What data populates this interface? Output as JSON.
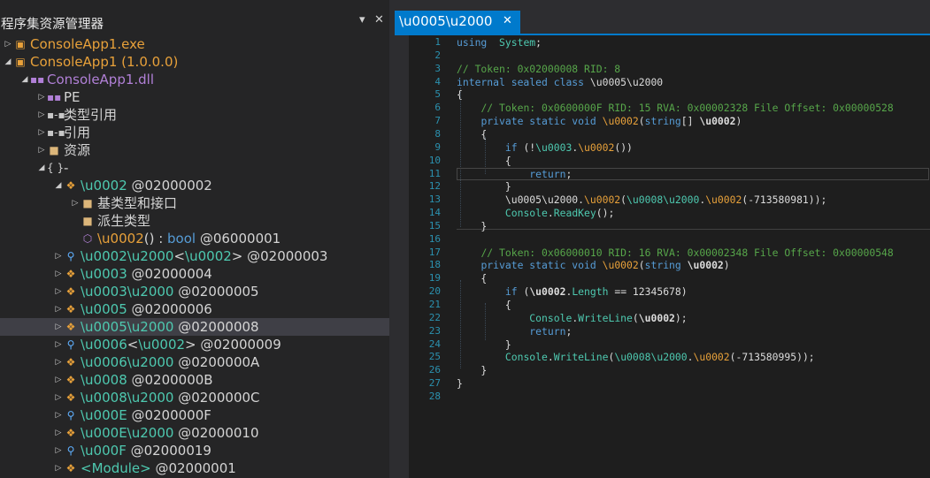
{
  "panel": {
    "title": "程序集资源管理器",
    "pin_glyph": "▾",
    "close_glyph": "✕"
  },
  "tree": [
    {
      "indent": 0,
      "arrow": "▷",
      "icon": "exe-icon",
      "glyph": "▣",
      "icon_color": "#e8a13a",
      "text": "ConsoleApp1.exe",
      "color": "#e8a13a"
    },
    {
      "indent": 0,
      "arrow": "◢",
      "icon": "assembly-icon",
      "glyph": "▣",
      "icon_color": "#e8a13a",
      "text": "ConsoleApp1 (1.0.0.0)",
      "color": "#e8a13a"
    },
    {
      "indent": 1,
      "arrow": "◢",
      "icon": "module-icon",
      "glyph": "▪▪",
      "icon_color": "#b180d7",
      "text": "ConsoleApp1.dll",
      "color": "#b180d7"
    },
    {
      "indent": 2,
      "arrow": "▷",
      "icon": "pe-icon",
      "glyph": "▪▪",
      "icon_color": "#b180d7",
      "text": "PE",
      "color": "#d4d4d4"
    },
    {
      "indent": 2,
      "arrow": "▷",
      "icon": "references-icon",
      "glyph": "▪-▪",
      "icon_color": "#c8c8c8",
      "text": "类型引用",
      "color": "#d4d4d4"
    },
    {
      "indent": 2,
      "arrow": "▷",
      "icon": "references-icon",
      "glyph": "▪-▪",
      "icon_color": "#c8c8c8",
      "text": "引用",
      "color": "#d4d4d4"
    },
    {
      "indent": 2,
      "arrow": "▷",
      "icon": "folder-icon",
      "glyph": "■",
      "icon_color": "#dcb67a",
      "text": "资源",
      "color": "#d4d4d4"
    },
    {
      "indent": 2,
      "arrow": "◢",
      "icon": "namespace-icon",
      "glyph": "{ }",
      "icon_color": "#d4d4d4",
      "text": "-",
      "color": "#d4d4d4"
    },
    {
      "indent": 3,
      "arrow": "◢",
      "icon": "class-icon",
      "glyph": "❖",
      "icon_color": "#e8a13a",
      "parts": [
        {
          "t": "\\u0002",
          "c": "#4ec9b0"
        },
        {
          "t": " @02000002",
          "c": "#d4d4d4"
        }
      ]
    },
    {
      "indent": 4,
      "arrow": "▷",
      "icon": "folder-icon",
      "glyph": "■",
      "icon_color": "#dcb67a",
      "text": "基类型和接口",
      "color": "#d4d4d4"
    },
    {
      "indent": 4,
      "arrow": "",
      "icon": "folder-icon",
      "glyph": "■",
      "icon_color": "#dcb67a",
      "text": "派生类型",
      "color": "#d4d4d4"
    },
    {
      "indent": 4,
      "arrow": "",
      "icon": "method-icon",
      "glyph": "⬡",
      "icon_color": "#b180d7",
      "parts": [
        {
          "t": "\\u0002",
          "c": "#e8a13a"
        },
        {
          "t": "() : ",
          "c": "#d4d4d4"
        },
        {
          "t": "bool",
          "c": "#569cd6"
        },
        {
          "t": " @06000001",
          "c": "#d4d4d4"
        }
      ]
    },
    {
      "indent": 3,
      "arrow": "▷",
      "icon": "class-generic-icon",
      "glyph": "⚲",
      "icon_color": "#5fb0ff",
      "parts": [
        {
          "t": "\\u0002\\u2000",
          "c": "#4ec9b0"
        },
        {
          "t": "<",
          "c": "#d4d4d4"
        },
        {
          "t": "\\u0002",
          "c": "#4ec9b0"
        },
        {
          "t": "> @02000003",
          "c": "#d4d4d4"
        }
      ]
    },
    {
      "indent": 3,
      "arrow": "▷",
      "icon": "class-icon",
      "glyph": "❖",
      "icon_color": "#e8a13a",
      "parts": [
        {
          "t": "\\u0003",
          "c": "#4ec9b0"
        },
        {
          "t": " @02000004",
          "c": "#d4d4d4"
        }
      ]
    },
    {
      "indent": 3,
      "arrow": "▷",
      "icon": "class-icon",
      "glyph": "❖",
      "icon_color": "#e8a13a",
      "parts": [
        {
          "t": "\\u0003\\u2000",
          "c": "#4ec9b0"
        },
        {
          "t": " @02000005",
          "c": "#d4d4d4"
        }
      ]
    },
    {
      "indent": 3,
      "arrow": "▷",
      "icon": "class-icon",
      "glyph": "❖",
      "icon_color": "#e8a13a",
      "parts": [
        {
          "t": "\\u0005",
          "c": "#4ec9b0"
        },
        {
          "t": " @02000006",
          "c": "#d4d4d4"
        }
      ]
    },
    {
      "indent": 3,
      "arrow": "▷",
      "icon": "class-icon",
      "glyph": "❖",
      "icon_color": "#e8a13a",
      "selected": true,
      "parts": [
        {
          "t": "\\u0005\\u2000",
          "c": "#4ec9b0"
        },
        {
          "t": " @02000008",
          "c": "#d4d4d4"
        }
      ]
    },
    {
      "indent": 3,
      "arrow": "▷",
      "icon": "class-generic-icon",
      "glyph": "⚲",
      "icon_color": "#5fb0ff",
      "parts": [
        {
          "t": "\\u0006",
          "c": "#4ec9b0"
        },
        {
          "t": "<",
          "c": "#d4d4d4"
        },
        {
          "t": "\\u0002",
          "c": "#4ec9b0"
        },
        {
          "t": "> @02000009",
          "c": "#d4d4d4"
        }
      ]
    },
    {
      "indent": 3,
      "arrow": "▷",
      "icon": "class-icon",
      "glyph": "❖",
      "icon_color": "#e8a13a",
      "parts": [
        {
          "t": "\\u0006\\u2000",
          "c": "#4ec9b0"
        },
        {
          "t": " @0200000A",
          "c": "#d4d4d4"
        }
      ]
    },
    {
      "indent": 3,
      "arrow": "▷",
      "icon": "class-icon",
      "glyph": "❖",
      "icon_color": "#e8a13a",
      "parts": [
        {
          "t": "\\u0008",
          "c": "#4ec9b0"
        },
        {
          "t": " @0200000B",
          "c": "#d4d4d4"
        }
      ]
    },
    {
      "indent": 3,
      "arrow": "▷",
      "icon": "class-icon",
      "glyph": "❖",
      "icon_color": "#e8a13a",
      "parts": [
        {
          "t": "\\u0008\\u2000",
          "c": "#4ec9b0"
        },
        {
          "t": " @0200000C",
          "c": "#d4d4d4"
        }
      ]
    },
    {
      "indent": 3,
      "arrow": "▷",
      "icon": "class-generic-icon",
      "glyph": "⚲",
      "icon_color": "#5fb0ff",
      "parts": [
        {
          "t": "\\u000E",
          "c": "#4ec9b0"
        },
        {
          "t": " @0200000F",
          "c": "#d4d4d4"
        }
      ]
    },
    {
      "indent": 3,
      "arrow": "▷",
      "icon": "class-icon",
      "glyph": "❖",
      "icon_color": "#e8a13a",
      "parts": [
        {
          "t": "\\u000E\\u2000",
          "c": "#4ec9b0"
        },
        {
          "t": " @02000010",
          "c": "#d4d4d4"
        }
      ]
    },
    {
      "indent": 3,
      "arrow": "▷",
      "icon": "class-generic-icon",
      "glyph": "⚲",
      "icon_color": "#5fb0ff",
      "parts": [
        {
          "t": "\\u000F",
          "c": "#4ec9b0"
        },
        {
          "t": " @02000019",
          "c": "#d4d4d4"
        }
      ]
    },
    {
      "indent": 3,
      "arrow": "▷",
      "icon": "class-icon",
      "glyph": "❖",
      "icon_color": "#e8a13a",
      "parts": [
        {
          "t": "<Module>",
          "c": "#4ec9b0"
        },
        {
          "t": " @02000001",
          "c": "#d4d4d4"
        }
      ]
    }
  ],
  "editor": {
    "tab_label": "\\u0005\\u2000",
    "tab_close": "✕",
    "current_line": 11,
    "lines": [
      [
        [
          "kw",
          "using"
        ],
        [
          "",
          "  "
        ],
        [
          "ty",
          "System"
        ],
        [
          "",
          ";"
        ]
      ],
      [],
      [
        [
          "cm",
          "// Token: 0x02000008 RID: 8"
        ]
      ],
      [
        [
          "kw",
          "internal sealed class"
        ],
        [
          "",
          " \\u0005\\u2000"
        ]
      ],
      [
        [
          "",
          "{"
        ]
      ],
      [
        [
          "",
          "    "
        ],
        [
          "cm",
          "// Token: 0x0600000F RID: 15 RVA: 0x00002328 File Offset: 0x00000528"
        ]
      ],
      [
        [
          "",
          "    "
        ],
        [
          "kw",
          "private static void"
        ],
        [
          "",
          " "
        ],
        [
          "or",
          "\\u0002"
        ],
        [
          "",
          "("
        ],
        [
          "kw",
          "string"
        ],
        [
          "",
          "[] "
        ],
        [
          "bd",
          "\\u0002"
        ],
        [
          "",
          ")"
        ]
      ],
      [
        [
          "",
          "    {"
        ]
      ],
      [
        [
          "",
          "        "
        ],
        [
          "kw",
          "if"
        ],
        [
          "",
          " (!"
        ],
        [
          "st",
          "\\u0003"
        ],
        [
          "",
          "."
        ],
        [
          "or",
          "\\u0002"
        ],
        [
          "",
          "())"
        ]
      ],
      [
        [
          "",
          "        {"
        ]
      ],
      [
        [
          "",
          "            "
        ],
        [
          "kw",
          "return"
        ],
        [
          "",
          ";"
        ]
      ],
      [
        [
          "",
          "        }"
        ]
      ],
      [
        [
          "",
          "        \\u0005\\u2000."
        ],
        [
          "or",
          "\\u0002"
        ],
        [
          "",
          "("
        ],
        [
          "st",
          "\\u0008\\u2000"
        ],
        [
          "",
          "."
        ],
        [
          "or",
          "\\u0002"
        ],
        [
          "",
          "(-713580981));"
        ]
      ],
      [
        [
          "",
          "        "
        ],
        [
          "ty",
          "Console"
        ],
        [
          "",
          "."
        ],
        [
          "ty",
          "ReadKey"
        ],
        [
          "",
          "();"
        ]
      ],
      [
        [
          "",
          "    }"
        ]
      ],
      [],
      [
        [
          "",
          "    "
        ],
        [
          "cm",
          "// Token: 0x06000010 RID: 16 RVA: 0x00002348 File Offset: 0x00000548"
        ]
      ],
      [
        [
          "",
          "    "
        ],
        [
          "kw",
          "private static void"
        ],
        [
          "",
          " "
        ],
        [
          "or",
          "\\u0002"
        ],
        [
          "",
          "("
        ],
        [
          "kw",
          "string"
        ],
        [
          "",
          " "
        ],
        [
          "bd",
          "\\u0002"
        ],
        [
          "",
          ")"
        ]
      ],
      [
        [
          "",
          "    {"
        ]
      ],
      [
        [
          "",
          "        "
        ],
        [
          "kw",
          "if"
        ],
        [
          "",
          " ("
        ],
        [
          "bd",
          "\\u0002"
        ],
        [
          "",
          "."
        ],
        [
          "ty",
          "Length"
        ],
        [
          "",
          " == 12345678)"
        ]
      ],
      [
        [
          "",
          "        {"
        ]
      ],
      [
        [
          "",
          "            "
        ],
        [
          "ty",
          "Console"
        ],
        [
          "",
          "."
        ],
        [
          "ty",
          "WriteLine"
        ],
        [
          "",
          "("
        ],
        [
          "bd",
          "\\u0002"
        ],
        [
          "",
          ");"
        ]
      ],
      [
        [
          "",
          "            "
        ],
        [
          "kw",
          "return"
        ],
        [
          "",
          ";"
        ]
      ],
      [
        [
          "",
          "        }"
        ]
      ],
      [
        [
          "",
          "        "
        ],
        [
          "ty",
          "Console"
        ],
        [
          "",
          "."
        ],
        [
          "ty",
          "WriteLine"
        ],
        [
          "",
          "("
        ],
        [
          "st",
          "\\u0008\\u2000"
        ],
        [
          "",
          "."
        ],
        [
          "or",
          "\\u0002"
        ],
        [
          "",
          "(-713580995));"
        ]
      ],
      [
        [
          "",
          "    }"
        ]
      ],
      [
        [
          "",
          "}"
        ]
      ],
      []
    ]
  }
}
